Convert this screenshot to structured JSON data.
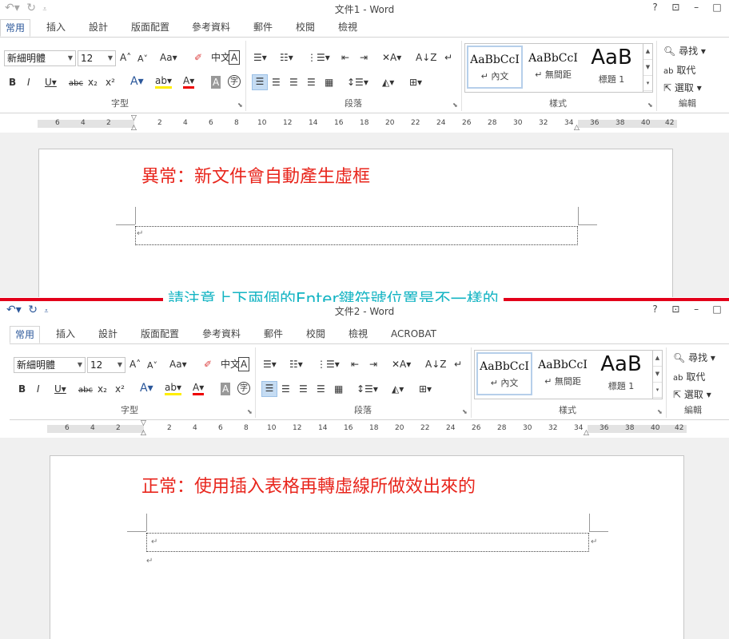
{
  "pane1": {
    "doc_title": "文件1 - Word",
    "qat_icons": [
      "undo-icon",
      "redo-icon",
      "customize-qat-icon"
    ],
    "win_buttons": [
      "?",
      "⊡",
      "–",
      "□"
    ],
    "tabs": [
      "常用",
      "插入",
      "設計",
      "版面配置",
      "參考資料",
      "郵件",
      "校閱",
      "檢視"
    ],
    "font_name": "新細明體",
    "font_size": "12",
    "group_font": "字型",
    "group_paragraph": "段落",
    "group_styles": "樣式",
    "group_editing": "編輯",
    "styles": [
      {
        "sample": "AaBbCcI",
        "name": "↵ 內文"
      },
      {
        "sample": "AaBbCcI",
        "name": "↵ 無間距"
      },
      {
        "sample": "AaB",
        "name": "標題 1"
      }
    ],
    "editing": [
      "尋找",
      "取代",
      "選取"
    ],
    "ruler_left": [
      "6",
      "4",
      "2"
    ],
    "ruler_right": [
      "2",
      "4",
      "6",
      "8",
      "10",
      "12",
      "14",
      "16",
      "18",
      "20",
      "22",
      "24",
      "26",
      "28",
      "30",
      "32",
      "34",
      "36",
      "38",
      "40",
      "42"
    ],
    "annotation": "異常：新文件會自動產生虛框",
    "para_mark": "↵"
  },
  "pane2": {
    "doc_title": "文件2 - Word",
    "qat_icons": [
      "undo-icon",
      "redo-icon",
      "customize-qat-icon"
    ],
    "win_buttons": [
      "?",
      "⊡",
      "–",
      "□"
    ],
    "tabs": [
      "常用",
      "插入",
      "設計",
      "版面配置",
      "參考資料",
      "郵件",
      "校閱",
      "檢視",
      "ACROBAT"
    ],
    "font_name": "新細明體",
    "font_size": "12",
    "group_font": "字型",
    "group_paragraph": "段落",
    "group_styles": "樣式",
    "group_editing": "編輯",
    "styles": [
      {
        "sample": "AaBbCcI",
        "name": "↵ 內文"
      },
      {
        "sample": "AaBbCcI",
        "name": "↵ 無間距"
      },
      {
        "sample": "AaB",
        "name": "標題 1"
      }
    ],
    "editing": [
      "尋找",
      "取代",
      "選取"
    ],
    "ruler_left": [
      "6",
      "4",
      "2"
    ],
    "ruler_right": [
      "2",
      "4",
      "6",
      "8",
      "10",
      "12",
      "14",
      "16",
      "18",
      "20",
      "22",
      "24",
      "26",
      "28",
      "30",
      "32",
      "34",
      "36",
      "38",
      "40",
      "42"
    ],
    "annotation": "正常：使用插入表格再轉虛線所做效出來的",
    "para_mark": "↵"
  },
  "callout": "請注意上下兩個的Enter鍵符號位置是不一樣的",
  "colors": {
    "accent": "#2b579a",
    "annotation_red": "#e8261d",
    "callout_cyan": "#14b4c3",
    "divider_red": "#e3001a"
  }
}
